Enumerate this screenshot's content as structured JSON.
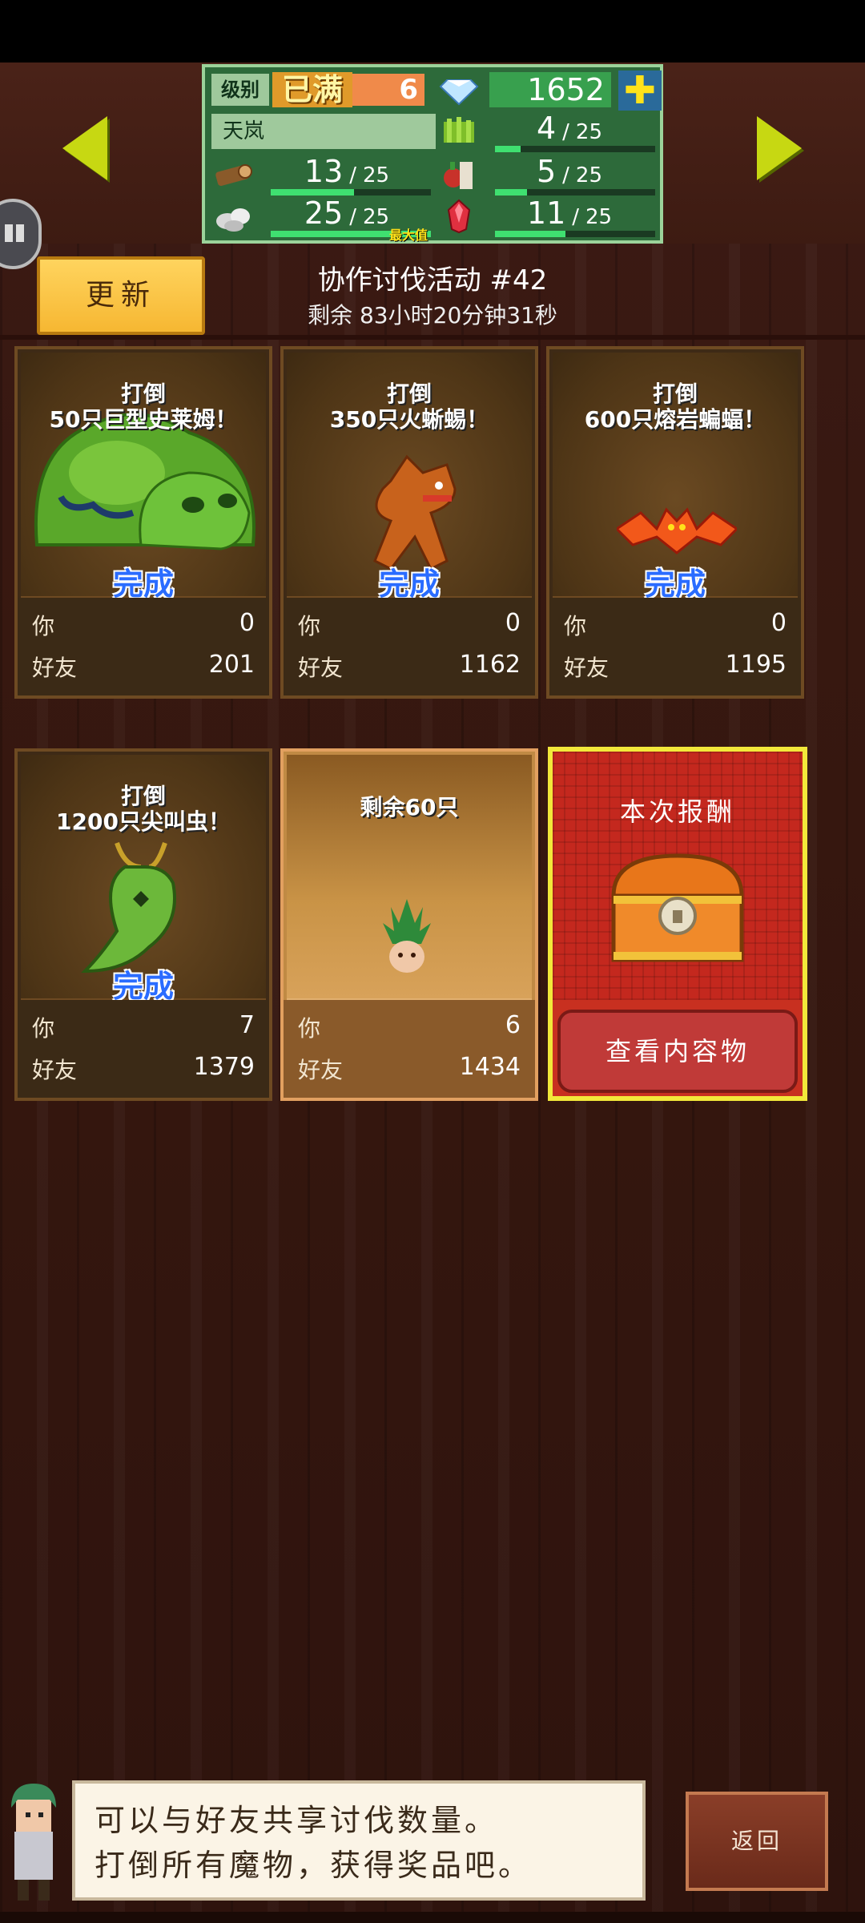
{
  "status": {
    "level_label": "级别",
    "level_max_label": "已满",
    "level": "6",
    "gems": "1652",
    "plus": "✚",
    "name": "天岚",
    "resources": [
      {
        "icon": "grass-icon",
        "value": "4",
        "max": "25",
        "fill": 0.16
      },
      {
        "icon": "wood-log-icon",
        "value": "13",
        "max": "25",
        "fill": 0.52
      },
      {
        "icon": "food-icon",
        "value": "5",
        "max": "25",
        "fill": 0.2
      },
      {
        "icon": "stone-icon",
        "value": "25",
        "max": "25",
        "fill": 1.0,
        "max_tag": "最大值"
      },
      {
        "icon": "ruby-icon",
        "value": "11",
        "max": "25",
        "fill": 0.44
      }
    ]
  },
  "header": {
    "refresh_label": "更新",
    "event_title": "协作讨伐活动 #42",
    "event_time": "剩余 83小时20分钟31秒"
  },
  "cards": [
    {
      "goal_line1": "打倒",
      "goal_line2": "50只巨型史莱姆！",
      "done": "完成",
      "you_label": "你",
      "you": "0",
      "friends_label": "好友",
      "friends": "201"
    },
    {
      "goal_line1": "打倒",
      "goal_line2": "350只火蜥蜴！",
      "done": "完成",
      "you_label": "你",
      "you": "0",
      "friends_label": "好友",
      "friends": "1162"
    },
    {
      "goal_line1": "打倒",
      "goal_line2": "600只熔岩蝙蝠！",
      "done": "完成",
      "you_label": "你",
      "you": "0",
      "friends_label": "好友",
      "friends": "1195"
    },
    {
      "goal_line1": "打倒",
      "goal_line2": "1200只尖叫虫！",
      "done": "完成",
      "you_label": "你",
      "you": "7",
      "friends_label": "好友",
      "friends": "1379"
    },
    {
      "goal_line1": "剩余60只",
      "goal_line2": "",
      "done": "",
      "you_label": "你",
      "you": "6",
      "friends_label": "好友",
      "friends": "1434"
    }
  ],
  "reward": {
    "title": "本次报酬",
    "view_button": "查看内容物"
  },
  "dialog": {
    "line1": "可以与好友共享讨伐数量。",
    "line2": "打倒所有魔物，获得奖品吧。"
  },
  "back_button": "返回"
}
